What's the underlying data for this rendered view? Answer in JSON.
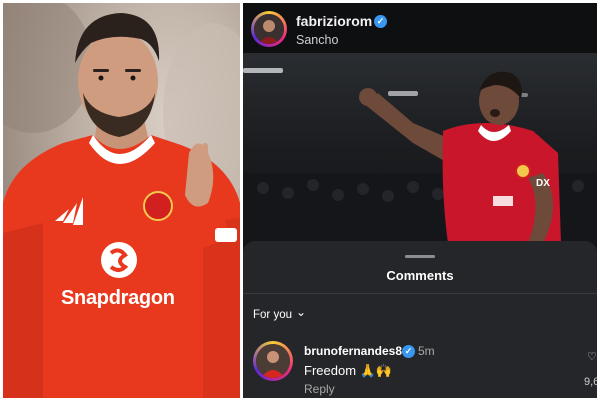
{
  "left_photo": {
    "sponsor_text": "Snapdragon",
    "kit_color": "#e8391f"
  },
  "post": {
    "username": "fabriziorom",
    "subtitle": "Sancho",
    "verified_icon": "verified-badge-icon"
  },
  "comments": {
    "title": "Comments",
    "filter_label": "For you",
    "filter_icon": "chevron-down-icon",
    "items": [
      {
        "username": "brunofernandes8",
        "time": "5m",
        "text": "Freedom 🙏🙌",
        "reply_label": "Reply",
        "likes": "9,6"
      }
    ]
  },
  "colors": {
    "panel_bg": "#0f1012",
    "sheet_bg": "#25262a",
    "verified": "#3897f0"
  }
}
